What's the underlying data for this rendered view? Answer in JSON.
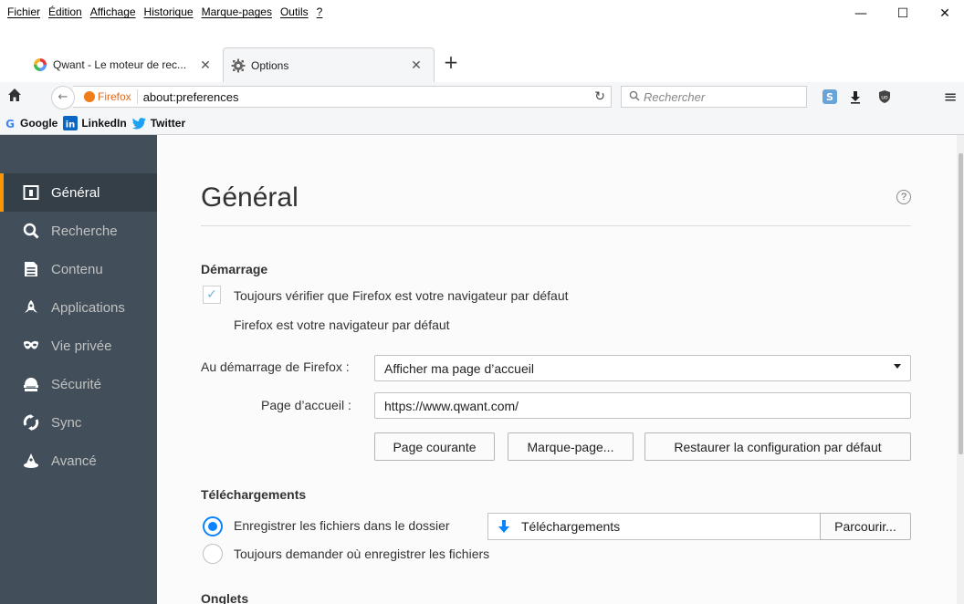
{
  "menubar": {
    "items": [
      "Fichier",
      "Édition",
      "Affichage",
      "Historique",
      "Marque-pages",
      "Outils",
      "?"
    ],
    "minimize": "—",
    "maximize": "☐",
    "close": "✕"
  },
  "tabs": [
    {
      "title": "Qwant - Le moteur de rec...",
      "close": "✕"
    },
    {
      "title": "Options",
      "close": "✕"
    }
  ],
  "newtab": "+",
  "navbar": {
    "identity_label": "Firefox",
    "url": "about:preferences",
    "search_placeholder": "Rechercher",
    "home": "⌂",
    "back": "←",
    "reload": "↻",
    "menu": "≡"
  },
  "bookmarks": [
    {
      "label": "Google"
    },
    {
      "label": "LinkedIn"
    },
    {
      "label": "Twitter"
    }
  ],
  "sidebar": {
    "items": [
      {
        "label": "Général",
        "icon": "general-icon"
      },
      {
        "label": "Recherche",
        "icon": "search-icon"
      },
      {
        "label": "Contenu",
        "icon": "document-icon"
      },
      {
        "label": "Applications",
        "icon": "rocket-icon"
      },
      {
        "label": "Vie privée",
        "icon": "mask-icon"
      },
      {
        "label": "Sécurité",
        "icon": "lock-icon"
      },
      {
        "label": "Sync",
        "icon": "sync-icon"
      },
      {
        "label": "Avancé",
        "icon": "wizard-icon"
      }
    ]
  },
  "main": {
    "title": "Général",
    "help": "?",
    "startup": {
      "heading": "Démarrage",
      "check_default_label": "Toujours vérifier que Firefox est votre navigateur par défaut",
      "check_mark": "✓",
      "is_default_text": "Firefox est votre navigateur par défaut",
      "on_start_label": "Au démarrage de Firefox :",
      "on_start_value": "Afficher ma page d’accueil",
      "homepage_label": "Page d’accueil :",
      "homepage_value": "https://www.qwant.com/",
      "btn_current": "Page courante",
      "btn_bookmark": "Marque-page...",
      "btn_restore": "Restaurer la configuration par défaut"
    },
    "downloads": {
      "heading": "Téléchargements",
      "save_to_label": "Enregistrer les fichiers dans le dossier",
      "folder": "Téléchargements",
      "browse": "Parcourir...",
      "always_ask_label": "Toujours demander où enregistrer les fichiers"
    },
    "tabs_heading": "Onglets"
  },
  "colors": {
    "sidebar_bg": "#424f5a",
    "sidebar_selected": "#343f48",
    "accent_orange": "#ff9500",
    "accent_blue": "#0a84ff"
  }
}
